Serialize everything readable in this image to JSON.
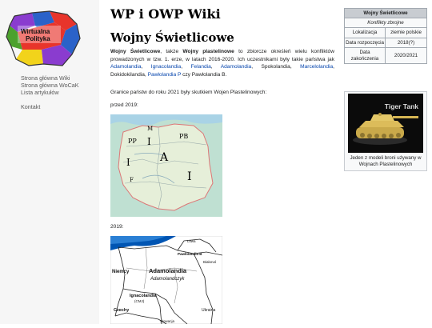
{
  "logo": {
    "line1": "Wirtualna",
    "line2": "Polityka"
  },
  "sidebar": {
    "links": [
      "Strona główna Wiki",
      "Strona główna WoCaK",
      "Lista artykułów"
    ],
    "contact": "Kontakt"
  },
  "site_title": "WP i OWP Wiki",
  "page_title": "Wojny Świetlicowe",
  "intro": {
    "subject": "Wojny Świetlicowe",
    "t1": ", także ",
    "alt": "Wojny plastelinowe",
    "t2": " to zbiorcze określeń wielu konfliktów prowadzonych w tzw. 1. erze, w latach 2016-2020. Ich uczestnikami były takie państwa jak ",
    "states": [
      "Adamolandia",
      "Ignacolandia",
      "Felandia",
      "Adamolandia",
      "Marcelolandia",
      "Pawłolandia P"
    ],
    "plain": [
      "Spokolandia",
      "Dokidokilandia"
    ],
    "end": " czy Pawłolandia B."
  },
  "borders_text": "Granice państw do roku 2021 były skutkiem Wojen Plastelinowych:",
  "before_label": "przed 2019:",
  "after_label": "2019:",
  "map1": {
    "labels": [
      "M",
      "PB",
      "PP",
      "I",
      "A",
      "I",
      "F"
    ]
  },
  "map2": {
    "labels": {
      "litwa": "Litwa",
      "pawlolandia": "Pawłolandia B",
      "bialorus": "Białoruś",
      "niemcy": "Niemcy",
      "adamolandia": "Adamolandia",
      "adamolandczyk": "Adamolandczyk",
      "ignacolandia": "Ignacolandia",
      "cmj": "(CMJ)",
      "czechy": "Czechy",
      "ukraina": "Ukraina",
      "slowacja": "Słowacja"
    }
  },
  "infobox": {
    "title": "Wojny Świetlicowe",
    "subtitle": "Konflikty zbrojne",
    "rows": [
      {
        "label": "Lokalizacja",
        "value": "ziemie polskie"
      },
      {
        "label": "Data rozpoczęcia",
        "value": "2018(?)"
      },
      {
        "label": "Data zakończenia",
        "value": "2020/2021"
      }
    ]
  },
  "thumb": {
    "image_text": "Tiger Tank",
    "caption": "Jeden z modeli broni używany w Wojnach Plastelinowych"
  },
  "colors": {
    "link": "#0645ad",
    "sidebar_bg": "#f6f6f6",
    "infobox_header": "#c8ccd1",
    "logo_red": "#e8342b",
    "logo_blue": "#2b62c9",
    "logo_green": "#4ca12e",
    "logo_purple": "#8a3ccf",
    "logo_yellow": "#f2d31b"
  }
}
